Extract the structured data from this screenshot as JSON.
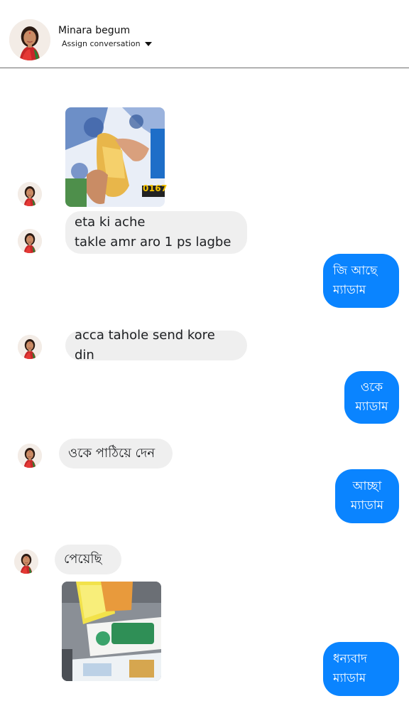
{
  "header": {
    "contact_name": "Minara begum",
    "assign_label": "Assign conversation"
  },
  "messages": {
    "photo_1_caption": "0167",
    "in_1_line1": "eta ki ache",
    "in_1_line2": "takle amr aro 1 ps lagbe",
    "out_1_line1": "জি আছে",
    "out_1_line2": "ম্যাডাম",
    "in_2": "acca tahole send kore din",
    "out_2_line1": "ওকে",
    "out_2_line2": "ম্যাডাম",
    "in_3": "ওকে পাঠিয়ে দেন",
    "out_3_line1": "আচ্ছা",
    "out_3_line2": "ম্যাডাম",
    "in_4": "পেয়েছি",
    "out_4_line1": "ধন্যবাদ",
    "out_4_line2": "ম্যাডাম"
  },
  "colors": {
    "outgoing_bubble": "#0a84ff",
    "incoming_bubble": "#efefef",
    "header_divider": "#6f6f6f"
  },
  "icons": {
    "assign_caret": "caret-down-icon"
  }
}
